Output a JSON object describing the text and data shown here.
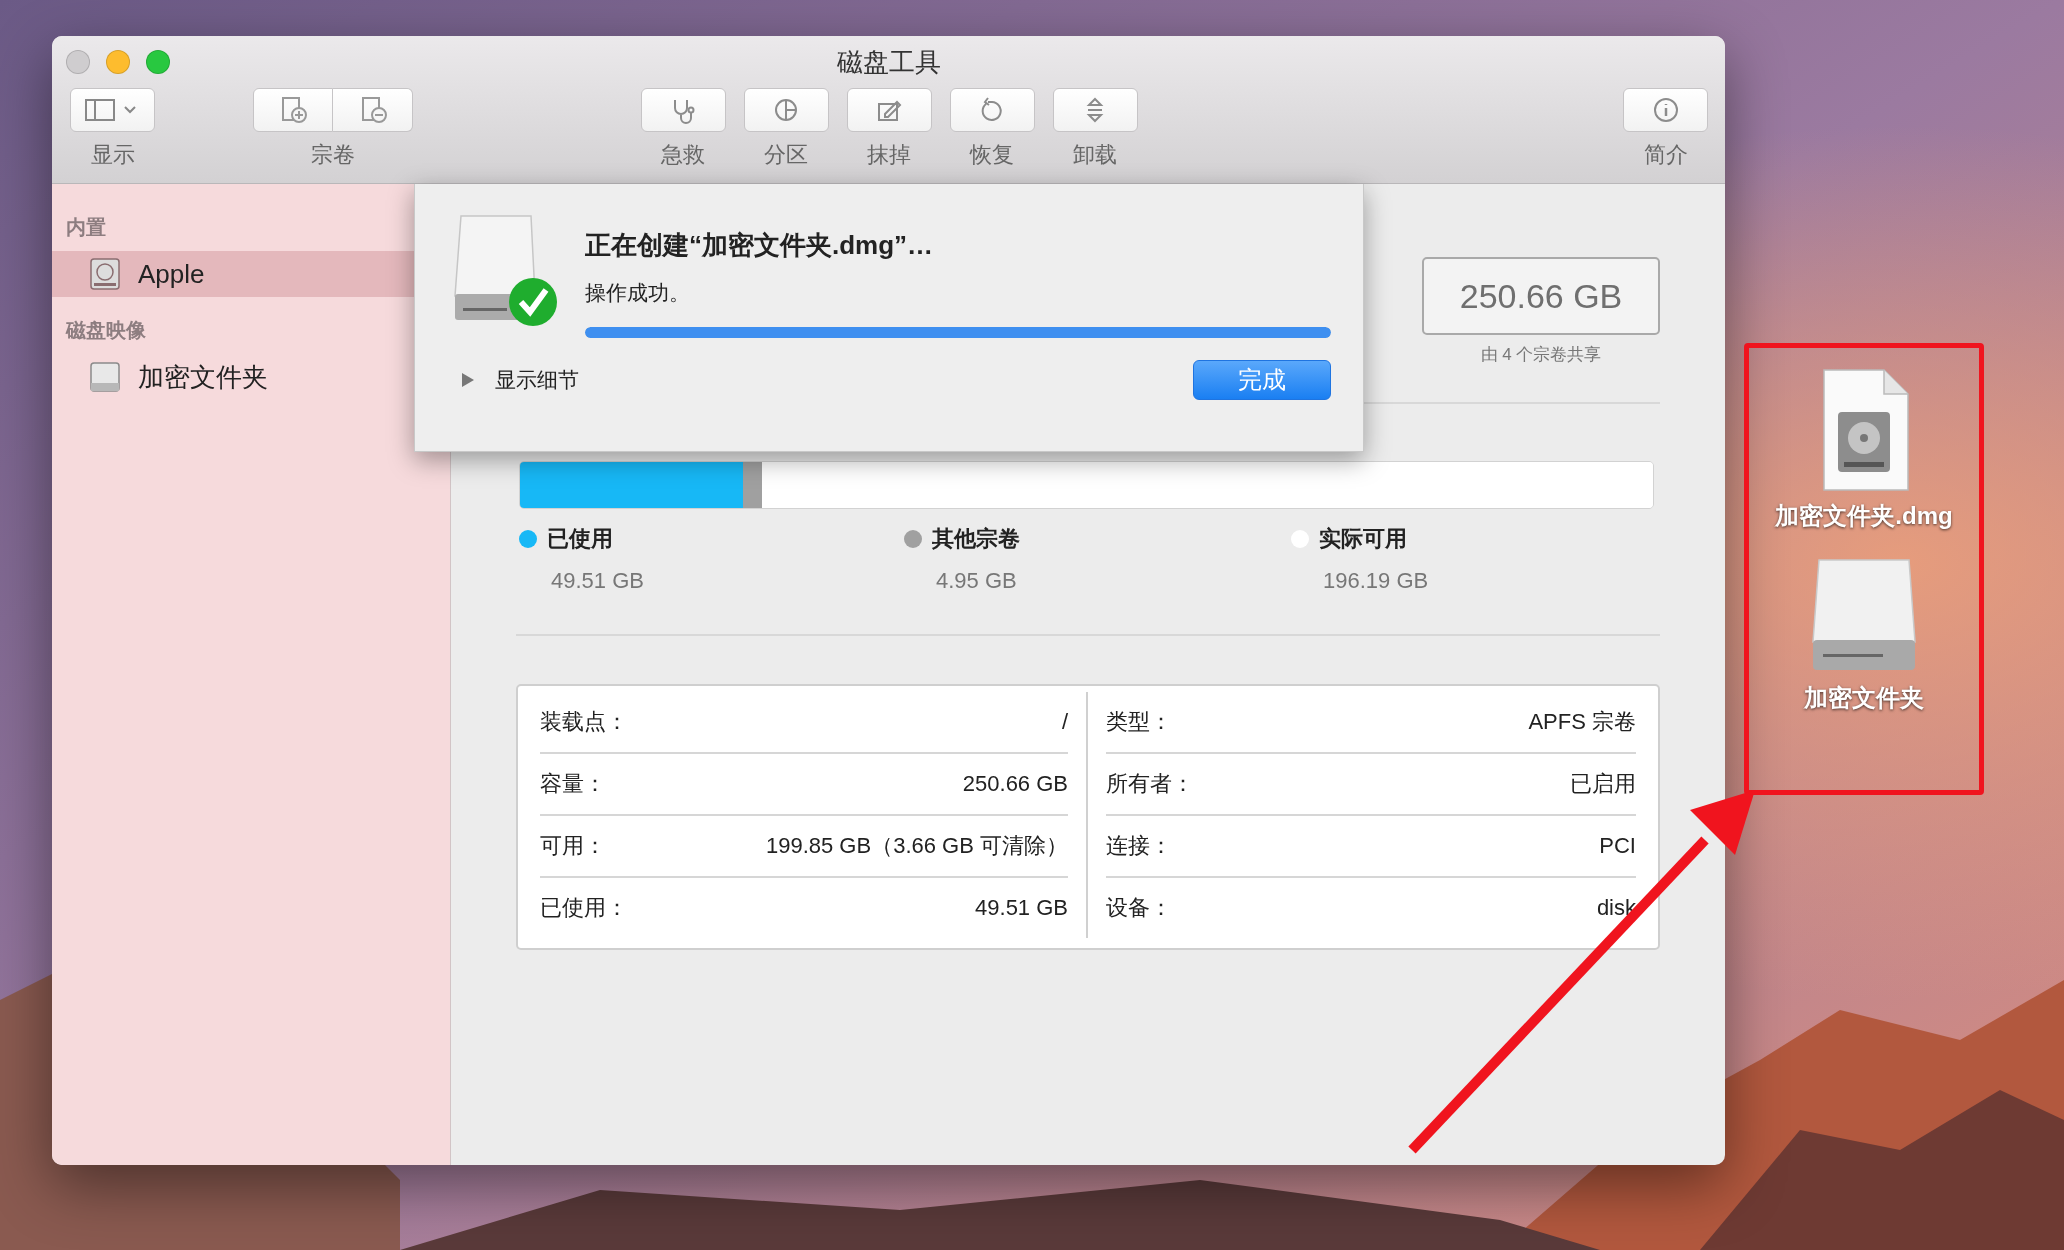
{
  "window": {
    "title": "磁盘工具"
  },
  "toolbar": [
    {
      "kind": "sidebar-toggle",
      "label": "显示"
    },
    {
      "kind": "volume",
      "label": "宗卷"
    },
    {
      "kind": "first-aid",
      "label": "急救"
    },
    {
      "kind": "partition",
      "label": "分区"
    },
    {
      "kind": "erase",
      "label": "抹掉"
    },
    {
      "kind": "restore",
      "label": "恢复"
    },
    {
      "kind": "unmount",
      "label": "卸载"
    },
    {
      "kind": "info",
      "label": "简介"
    }
  ],
  "sidebar": {
    "sections": [
      {
        "heading": "内置",
        "items": [
          {
            "label": "Apple",
            "kind": "internal",
            "selected": true
          }
        ]
      },
      {
        "heading": "磁盘映像",
        "items": [
          {
            "label": "加密文件夹",
            "selected": false
          }
        ]
      }
    ]
  },
  "dialog": {
    "title": "正在创建“加密文件夹.dmg”…",
    "status": "操作成功。",
    "progress": {
      "level": 1.0
    },
    "details": "显示细节",
    "button": "完成"
  },
  "capacity": {
    "value": "250.66 GB",
    "caption": "由 4 个宗卷共享"
  },
  "usage": {
    "segments": [
      {
        "label": "已使用",
        "value": "49.51 GB",
        "color": "#17b8f6",
        "level": 0.197
      },
      {
        "label": "其他宗卷",
        "value": "4.95 GB",
        "color": "#a0a0a0",
        "level": 0.017
      },
      {
        "label": "实际可用",
        "value": "196.19 GB",
        "color": "#ffffff",
        "level": 0.786
      }
    ]
  },
  "info": {
    "left": [
      {
        "label": "装载点：",
        "value": "/"
      },
      {
        "label": "容量：",
        "value": "250.66 GB"
      },
      {
        "label": "可用：",
        "value": "199.85 GB（3.66 GB 可清除）"
      },
      {
        "label": "已使用：",
        "value": "49.51 GB"
      }
    ],
    "right": [
      {
        "label": "类型：",
        "value": "APFS 宗卷"
      },
      {
        "label": "所有者：",
        "value": "已启用"
      },
      {
        "label": "连接：",
        "value": "PCI"
      },
      {
        "label": "设备：",
        "value": "disk"
      }
    ]
  },
  "desktop_icons": [
    {
      "kind": "dmg",
      "label": "加密文件夹.dmg"
    },
    {
      "kind": "volume",
      "label": "加密文件夹"
    }
  ]
}
